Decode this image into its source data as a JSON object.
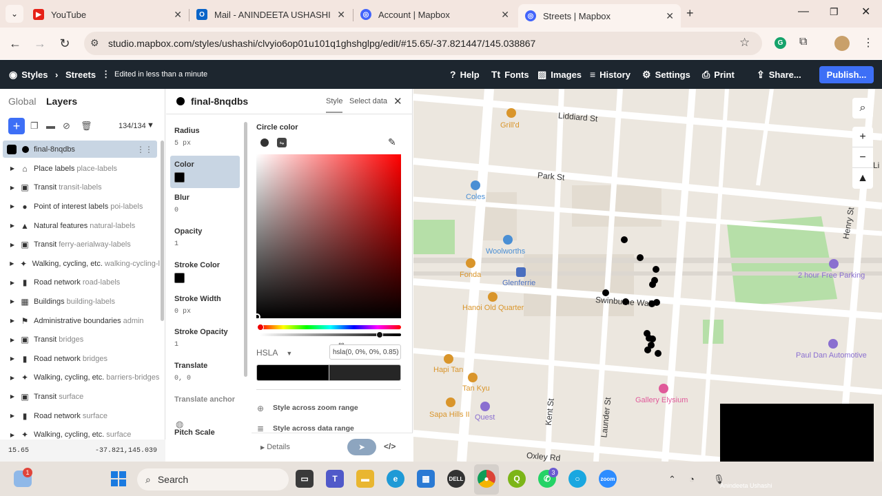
{
  "browser": {
    "tabs": [
      {
        "title": "YouTube",
        "active": false
      },
      {
        "title": "Mail - ANINDEETA USHASHI - O",
        "active": false
      },
      {
        "title": "Account | Mapbox",
        "active": false
      },
      {
        "title": "Streets | Mapbox",
        "active": true
      }
    ],
    "url": "studio.mapbox.com/styles/ushashi/clvyio6op01u101q1ghshglpg/edit/#15.65/-37.821447/145.038867"
  },
  "app": {
    "styles_label": "Styles",
    "style_name": "Streets",
    "edit_status": "Edited in less than a minute",
    "menu": {
      "help": "Help",
      "fonts": "Fonts",
      "images": "Images",
      "history": "History",
      "settings": "Settings",
      "print": "Print",
      "share": "Share...",
      "publish": "Publish..."
    }
  },
  "left_panel": {
    "tab_global": "Global",
    "tab_layers": "Layers",
    "layer_count": "134/134",
    "selected_layer": "final-8nqdbs",
    "layers": [
      {
        "name": "Place labels",
        "id": "place-labels",
        "icon": "place-labels-icon",
        "glyph": "⌂"
      },
      {
        "name": "Transit",
        "id": "transit-labels",
        "icon": "transit-icon",
        "glyph": "▣"
      },
      {
        "name": "Point of interest labels",
        "id": "poi-labels",
        "icon": "pin-icon",
        "glyph": "●"
      },
      {
        "name": "Natural features",
        "id": "natural-labels",
        "icon": "mountain-icon",
        "glyph": "▲"
      },
      {
        "name": "Transit",
        "id": "ferry-aerialway-labels",
        "icon": "transit-icon",
        "glyph": "▣"
      },
      {
        "name": "Walking, cycling, etc.",
        "id": "walking-cycling-l",
        "icon": "walker-icon",
        "glyph": "✦"
      },
      {
        "name": "Road network",
        "id": "road-labels",
        "icon": "road-icon",
        "glyph": "▮"
      },
      {
        "name": "Buildings",
        "id": "building-labels",
        "icon": "building-icon",
        "glyph": "▦"
      },
      {
        "name": "Administrative boundaries",
        "id": "admin",
        "icon": "flag-icon",
        "glyph": "⚑"
      },
      {
        "name": "Transit",
        "id": "bridges",
        "icon": "transit-icon",
        "glyph": "▣"
      },
      {
        "name": "Road network",
        "id": "bridges",
        "icon": "road-icon",
        "glyph": "▮"
      },
      {
        "name": "Walking, cycling, etc.",
        "id": "barriers-bridges",
        "icon": "walker-icon",
        "glyph": "✦"
      },
      {
        "name": "Transit",
        "id": "surface",
        "icon": "transit-icon",
        "glyph": "▣"
      },
      {
        "name": "Road network",
        "id": "surface",
        "icon": "road-icon",
        "glyph": "▮"
      },
      {
        "name": "Walking, cycling, etc.",
        "id": "surface",
        "icon": "walker-icon",
        "glyph": "✦"
      }
    ],
    "zoom": "15.65",
    "coords": "-37.821,145.039"
  },
  "layer_editor": {
    "layer_name": "final-8nqdbs",
    "tab_style": "Style",
    "tab_select_data": "Select data",
    "props": [
      {
        "label": "Radius",
        "value": "5 px"
      },
      {
        "label": "Color",
        "value": ""
      },
      {
        "label": "Blur",
        "value": "0"
      },
      {
        "label": "Opacity",
        "value": "1"
      },
      {
        "label": "Stroke Color",
        "value": ""
      },
      {
        "label": "Stroke Width",
        "value": "0 px"
      },
      {
        "label": "Stroke Opacity",
        "value": "1"
      },
      {
        "label": "Translate",
        "value": "0, 0"
      },
      {
        "label": "Translate anchor",
        "value": ""
      },
      {
        "label": "Pitch Scale",
        "value": ""
      }
    ],
    "circle_color_label": "Circle color",
    "color_mode": "HSLA",
    "color_value": "hsla(0, 0%, 0%, 0.85)",
    "alpha": 0.85,
    "style_zoom": "Style across zoom range",
    "style_data": "Style across data range",
    "details": "Details"
  },
  "map": {
    "streets": [
      "Liddiard St",
      "Park St",
      "Swinburne Walk",
      "Kent St",
      "Launder St",
      "Oxley Rd",
      "Henry St",
      "Li"
    ],
    "pois": [
      {
        "name": "Grill'd",
        "color": "#d9952b"
      },
      {
        "name": "Coles",
        "color": "#4a8fd4"
      },
      {
        "name": "Woolworths",
        "color": "#4a8fd4"
      },
      {
        "name": "Fonda",
        "color": "#d9952b"
      },
      {
        "name": "Glenferrie",
        "color": "#4a6fbf"
      },
      {
        "name": "Hanoi Old Quarter",
        "color": "#d9952b"
      },
      {
        "name": "Hapi Tan",
        "color": "#d9952b"
      },
      {
        "name": "Tan Kyu",
        "color": "#d9952b"
      },
      {
        "name": "Sapa Hills II",
        "color": "#d9952b"
      },
      {
        "name": "Quest",
        "color": "#8a6fd0"
      },
      {
        "name": "Gallery Elysium",
        "color": "#e05a9a"
      },
      {
        "name": "2 hour Free Parking",
        "color": "#8a6fd0"
      },
      {
        "name": "Paul Dan Automotive",
        "color": "#8a6fd0"
      }
    ],
    "video_overlay_name": "Anindeeta Ushashi"
  },
  "taskbar": {
    "search": "Search",
    "badge_weather": "1",
    "badge_whatsapp": "3"
  }
}
